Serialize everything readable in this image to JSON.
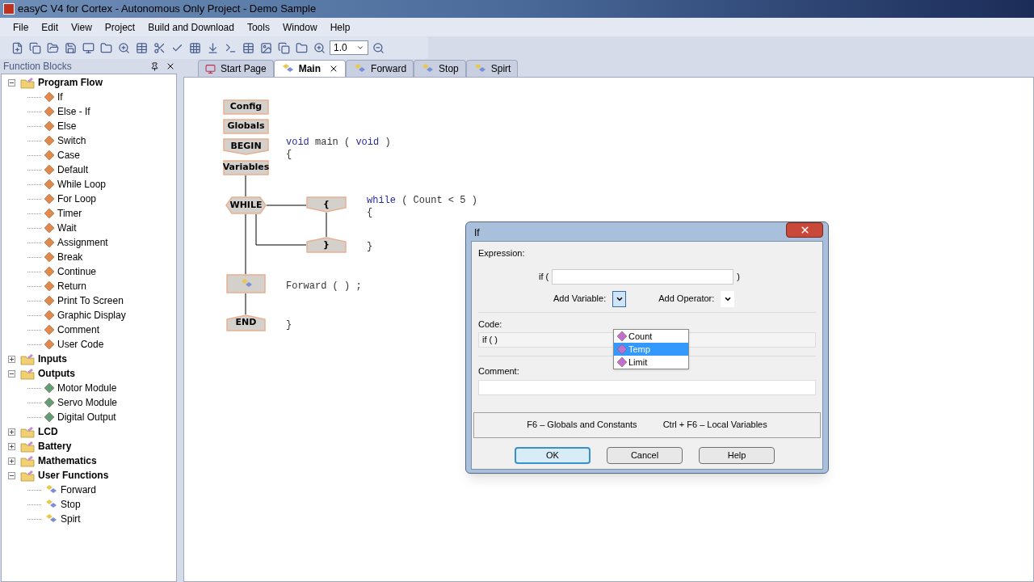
{
  "window": {
    "title": "easyC V4 for Cortex - Autonomous Only Project - Demo Sample"
  },
  "menu": [
    "File",
    "Edit",
    "View",
    "Project",
    "Build and Download",
    "Tools",
    "Window",
    "Help"
  ],
  "toolbar": {
    "zoom": "1.0"
  },
  "panel": {
    "title": "Function Blocks",
    "tree": [
      {
        "label": "Program Flow",
        "kind": "folder",
        "expanded": true,
        "children": [
          {
            "label": "If",
            "kind": "block"
          },
          {
            "label": "Else - If",
            "kind": "block"
          },
          {
            "label": "Else",
            "kind": "block"
          },
          {
            "label": "Switch",
            "kind": "block"
          },
          {
            "label": "Case",
            "kind": "block"
          },
          {
            "label": "Default",
            "kind": "block"
          },
          {
            "label": "While Loop",
            "kind": "block"
          },
          {
            "label": "For Loop",
            "kind": "block"
          },
          {
            "label": "Timer",
            "kind": "block"
          },
          {
            "label": "Wait",
            "kind": "block"
          },
          {
            "label": "Assignment",
            "kind": "block"
          },
          {
            "label": "Break",
            "kind": "block"
          },
          {
            "label": "Continue",
            "kind": "block"
          },
          {
            "label": "Return",
            "kind": "block"
          },
          {
            "label": "Print To Screen",
            "kind": "block"
          },
          {
            "label": "Graphic Display",
            "kind": "block"
          },
          {
            "label": "Comment",
            "kind": "block"
          },
          {
            "label": "User Code",
            "kind": "block"
          }
        ]
      },
      {
        "label": "Inputs",
        "kind": "folder",
        "expanded": false
      },
      {
        "label": "Outputs",
        "kind": "folder",
        "expanded": true,
        "children": [
          {
            "label": "Motor Module",
            "kind": "output"
          },
          {
            "label": "Servo Module",
            "kind": "output"
          },
          {
            "label": "Digital Output",
            "kind": "output"
          }
        ]
      },
      {
        "label": "LCD",
        "kind": "folder",
        "expanded": false
      },
      {
        "label": "Battery",
        "kind": "folder",
        "expanded": false
      },
      {
        "label": "Mathematics",
        "kind": "folder",
        "expanded": false
      },
      {
        "label": "User Functions",
        "kind": "folder",
        "expanded": true,
        "children": [
          {
            "label": "Forward",
            "kind": "function"
          },
          {
            "label": "Stop",
            "kind": "function"
          },
          {
            "label": "Spirt",
            "kind": "function"
          }
        ]
      }
    ]
  },
  "tabs": [
    {
      "label": "Start Page",
      "kind": "start",
      "selected": false
    },
    {
      "label": "Main",
      "kind": "function",
      "selected": true
    },
    {
      "label": "Forward",
      "kind": "function",
      "selected": false
    },
    {
      "label": "Stop",
      "kind": "function",
      "selected": false
    },
    {
      "label": "Spirt",
      "kind": "function",
      "selected": false
    }
  ],
  "flowchart": {
    "nodes": [
      {
        "label": "Config",
        "kind": "rect"
      },
      {
        "label": "Globals",
        "kind": "rect"
      },
      {
        "label": "BEGIN",
        "kind": "begin"
      },
      {
        "label": "Variables",
        "kind": "rect"
      },
      {
        "label": "WHILE",
        "kind": "hex"
      },
      {
        "label": "{",
        "kind": "open"
      },
      {
        "label": "}",
        "kind": "close"
      },
      {
        "kind": "call"
      },
      {
        "label": "END",
        "kind": "end"
      }
    ],
    "code": [
      {
        "tokens": [
          {
            "text": "void",
            "kind": "keyword"
          },
          {
            "text": " main ( ",
            "kind": "plain"
          },
          {
            "text": "void",
            "kind": "keyword"
          },
          {
            "text": " )",
            "kind": "plain"
          }
        ]
      },
      {
        "tokens": [
          {
            "text": "{",
            "kind": "plain"
          }
        ]
      },
      {
        "tokens": [
          {
            "text": "while",
            "kind": "keyword"
          },
          {
            "text": " ( Count < 5 )",
            "kind": "plain"
          }
        ]
      },
      {
        "tokens": [
          {
            "text": "{",
            "kind": "plain"
          }
        ]
      },
      {
        "tokens": [
          {
            "text": "}",
            "kind": "plain"
          }
        ]
      },
      {
        "tokens": [
          {
            "text": "Forward ( ) ;",
            "kind": "plain"
          }
        ]
      },
      {
        "tokens": [
          {
            "text": "}",
            "kind": "plain"
          }
        ]
      }
    ]
  },
  "dialog": {
    "title": "If",
    "expression_label": "Expression:",
    "if_open": "if (",
    "if_close": ")",
    "add_variable": "Add Variable:",
    "add_operator": "Add Operator:",
    "variables": [
      {
        "label": "Count",
        "selected": false
      },
      {
        "label": "Temp",
        "selected": true
      },
      {
        "label": "Limit",
        "selected": false
      }
    ],
    "code_label": "Code:",
    "code_value": "if ( )",
    "comment_label": "Comment:",
    "hint_globals": "F6 – Globals and Constants",
    "hint_locals": "Ctrl + F6 – Local Variables",
    "buttons": [
      {
        "label": "OK",
        "default": true
      },
      {
        "label": "Cancel",
        "default": false
      },
      {
        "label": "Help",
        "default": false
      }
    ]
  }
}
